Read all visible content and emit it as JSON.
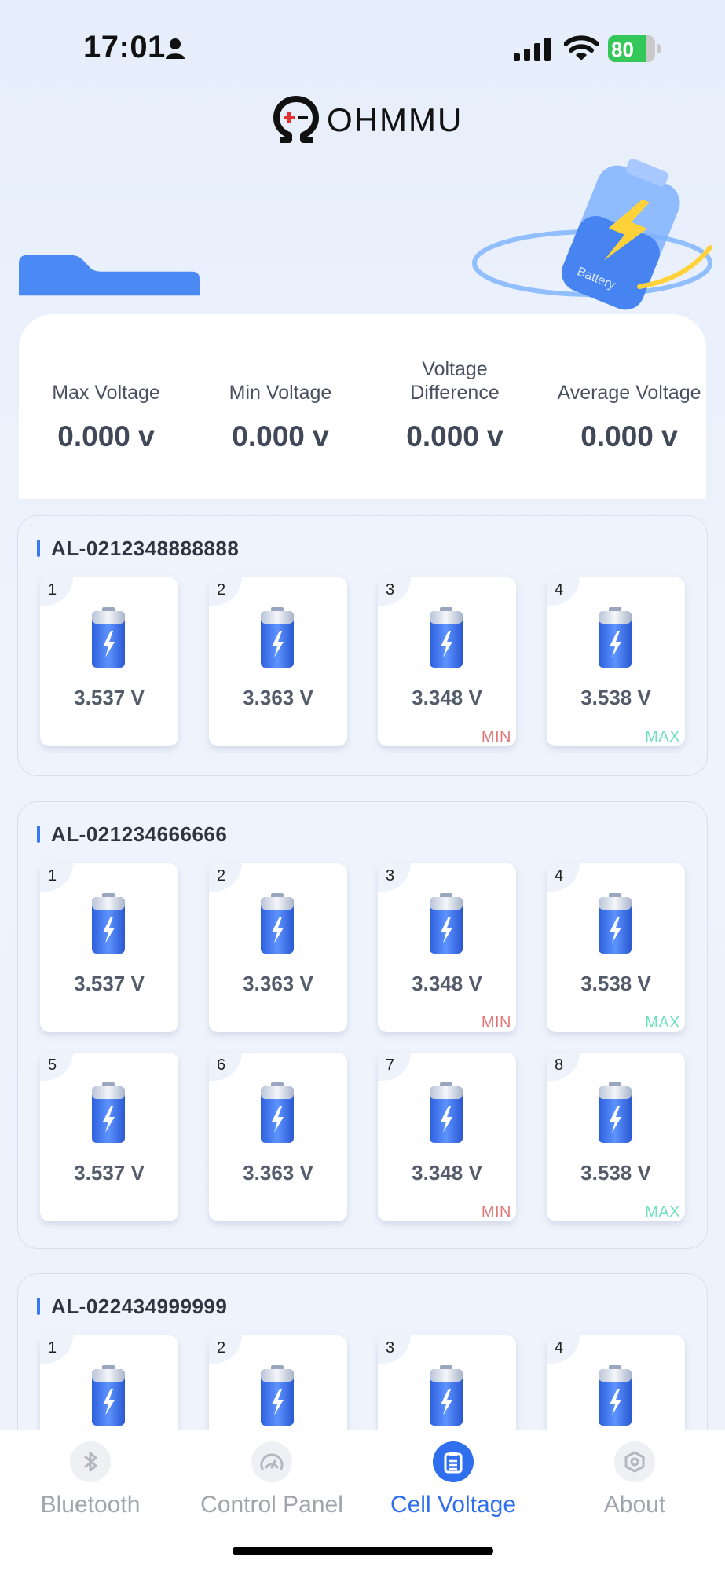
{
  "status_bar": {
    "time": "17:01",
    "battery_percent": "80",
    "battery_level": 0.8
  },
  "header": {
    "brand": "OHMMU"
  },
  "illustration": {
    "battery_text": "Battery"
  },
  "summary": {
    "max": {
      "label": "Max Voltage",
      "value": "0.000 v"
    },
    "min": {
      "label": "Min Voltage",
      "value": "0.000 v"
    },
    "diff": {
      "label": "Voltage Difference",
      "value": "0.000 v"
    },
    "avg": {
      "label": "Average Voltage",
      "value": "0.000 v"
    }
  },
  "packs": [
    {
      "id": "AL-0212348888888",
      "cells": [
        {
          "index": "1",
          "voltage": "3.537 V",
          "tag": ""
        },
        {
          "index": "2",
          "voltage": "3.363 V",
          "tag": ""
        },
        {
          "index": "3",
          "voltage": "3.348 V",
          "tag": "MIN"
        },
        {
          "index": "4",
          "voltage": "3.538 V",
          "tag": "MAX"
        }
      ]
    },
    {
      "id": "AL-021234666666",
      "cells": [
        {
          "index": "1",
          "voltage": "3.537 V",
          "tag": ""
        },
        {
          "index": "2",
          "voltage": "3.363 V",
          "tag": ""
        },
        {
          "index": "3",
          "voltage": "3.348 V",
          "tag": "MIN"
        },
        {
          "index": "4",
          "voltage": "3.538 V",
          "tag": "MAX"
        },
        {
          "index": "5",
          "voltage": "3.537 V",
          "tag": ""
        },
        {
          "index": "6",
          "voltage": "3.363 V",
          "tag": ""
        },
        {
          "index": "7",
          "voltage": "3.348 V",
          "tag": "MIN"
        },
        {
          "index": "8",
          "voltage": "3.538 V",
          "tag": "MAX"
        }
      ]
    },
    {
      "id": "AL-022434999999",
      "cells": [
        {
          "index": "1",
          "voltage": "",
          "tag": ""
        },
        {
          "index": "2",
          "voltage": "",
          "tag": ""
        },
        {
          "index": "3",
          "voltage": "",
          "tag": ""
        },
        {
          "index": "4",
          "voltage": "",
          "tag": ""
        }
      ]
    }
  ],
  "tabbar": {
    "tabs": [
      {
        "label": "Bluetooth",
        "icon": "bluetooth-icon",
        "active": false
      },
      {
        "label": "Control Panel",
        "icon": "gauge-icon",
        "active": false
      },
      {
        "label": "Cell Voltage",
        "icon": "clipboard-icon",
        "active": true
      },
      {
        "label": "About",
        "icon": "hexagon-icon",
        "active": false
      }
    ]
  },
  "colors": {
    "accent": "#2f6fed",
    "header_blue": "#4b8af5",
    "min": "#e27777",
    "max": "#6ee0c0"
  }
}
